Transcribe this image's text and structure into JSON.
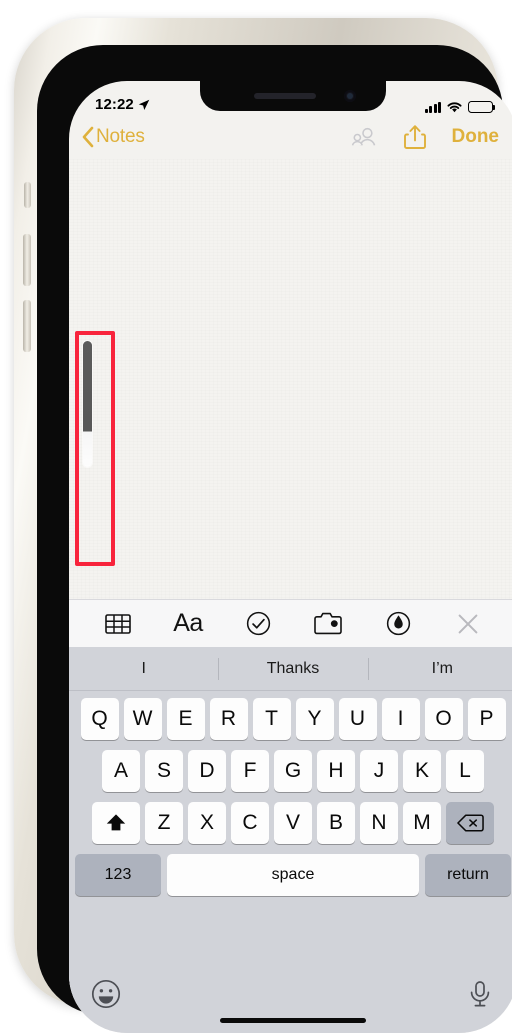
{
  "device": {
    "name": "iphone-notes-screenshot",
    "frame_color": "#e6e2d8"
  },
  "status_bar": {
    "time": "12:22",
    "location_icon": "location-arrow-icon",
    "cellular_icon": "signal-bars-icon",
    "wifi_icon": "wifi-icon",
    "battery_icon": "battery-full-icon"
  },
  "nav_bar": {
    "back_label": "Notes",
    "back_chevron": "chevron-left-icon",
    "collaborate_icon": "add-person-icon",
    "share_icon": "share-icon",
    "done_label": "Done",
    "accent_color": "#dfb13c",
    "disabled_color": "#c9c9cd"
  },
  "note": {
    "body_text": "",
    "caret_visible": true
  },
  "annotation": {
    "shape": "rectangle",
    "color": "#f8243c",
    "target": "text-caret-scroll-indicator"
  },
  "format_toolbar": {
    "items": [
      {
        "name": "table-icon",
        "label": ""
      },
      {
        "name": "text-format-icon",
        "label": "Aa"
      },
      {
        "name": "checklist-icon",
        "label": ""
      },
      {
        "name": "camera-icon",
        "label": ""
      },
      {
        "name": "markup-pen-icon",
        "label": ""
      },
      {
        "name": "close-icon",
        "label": ""
      }
    ]
  },
  "keyboard": {
    "predictions": [
      "I",
      "Thanks",
      "I’m"
    ],
    "row1": [
      "Q",
      "W",
      "E",
      "R",
      "T",
      "Y",
      "U",
      "I",
      "O",
      "P"
    ],
    "row2": [
      "A",
      "S",
      "D",
      "F",
      "G",
      "H",
      "J",
      "K",
      "L"
    ],
    "row3": [
      "Z",
      "X",
      "C",
      "V",
      "B",
      "N",
      "M"
    ],
    "shift_icon": "shift-icon",
    "delete_icon": "delete-backspace-icon",
    "numbers_label": "123",
    "space_label": "space",
    "return_label": "return",
    "emoji_icon": "emoji-smiley-icon",
    "dictation_icon": "microphone-icon"
  }
}
